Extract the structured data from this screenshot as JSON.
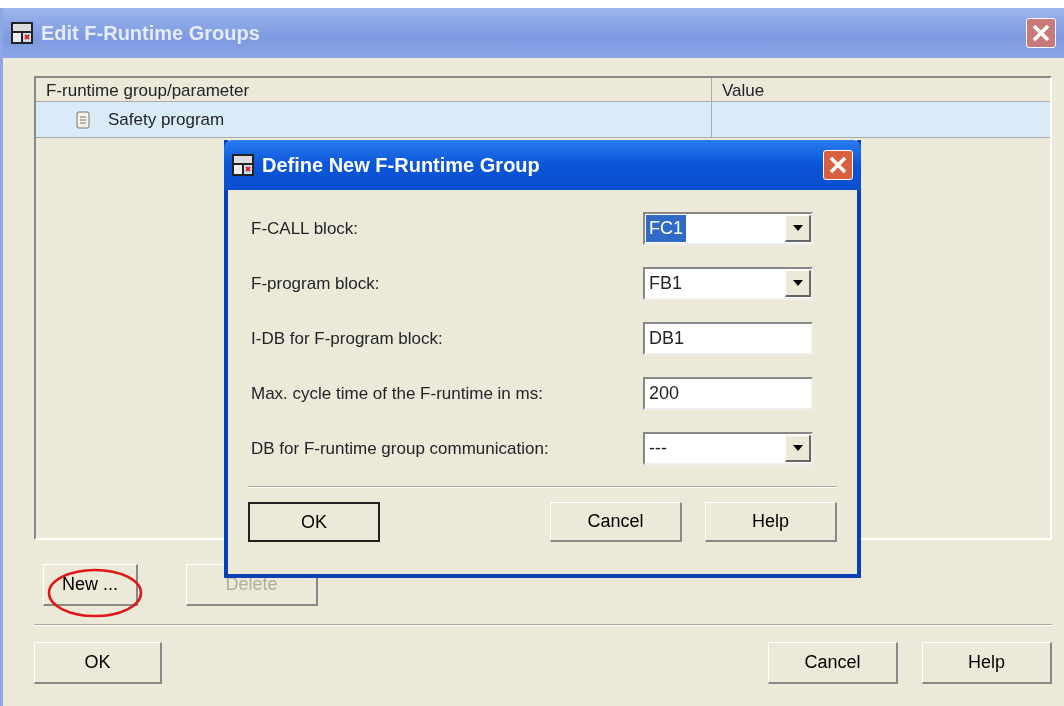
{
  "window": {
    "title": "Edit F-Runtime Groups",
    "active": false
  },
  "table": {
    "columns": [
      "F-runtime group/parameter",
      "Value"
    ],
    "rows": [
      {
        "name": "Safety program",
        "value": "",
        "selected": true
      }
    ]
  },
  "list_buttons": [
    {
      "label": "New ...",
      "disabled": false,
      "circled": true
    },
    {
      "label": "Delete",
      "disabled": true,
      "circled": false
    }
  ],
  "footer_buttons": [
    {
      "label": "OK"
    },
    {
      "label": "Cancel"
    },
    {
      "label": "Help"
    }
  ],
  "dialog": {
    "title": "Define New F-Runtime Group",
    "active": true,
    "fields": [
      {
        "label": "F-CALL block:",
        "kind": "dropdown",
        "value": "FC1",
        "highlighted": true
      },
      {
        "label": "F-program block:",
        "kind": "dropdown",
        "value": "FB1",
        "highlighted": false
      },
      {
        "label": "I-DB for F-program block:",
        "kind": "text",
        "value": "DB1",
        "highlighted": false
      },
      {
        "label": "Max. cycle time of the F-runtime in ms:",
        "kind": "text",
        "value": "200",
        "highlighted": false
      },
      {
        "label": "DB for F-runtime group communication:",
        "kind": "dropdown",
        "value": "---",
        "highlighted": false
      }
    ],
    "buttons": [
      {
        "label": "OK",
        "default": true
      },
      {
        "label": "Cancel",
        "default": false
      },
      {
        "label": "Help",
        "default": false
      }
    ]
  }
}
